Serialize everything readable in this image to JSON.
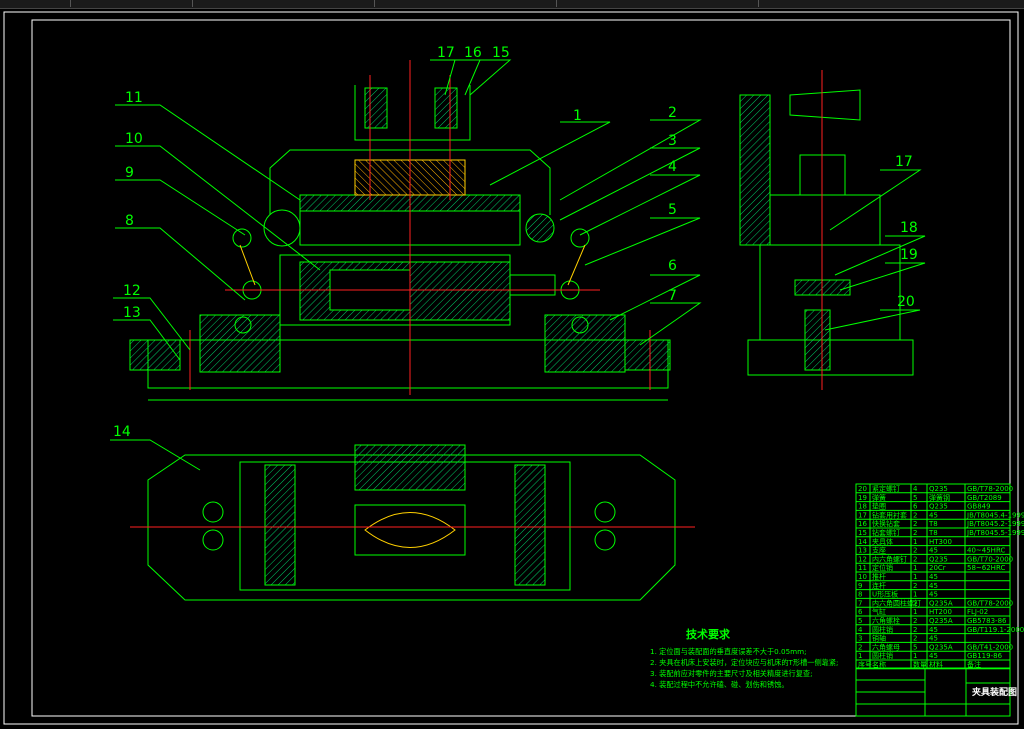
{
  "title_block": {
    "drawing_title": "夹具装配图"
  },
  "technical_requirements": {
    "heading": "技术要求",
    "items": [
      "1. 定位面与装配面的垂直度误差不大于0.05mm;",
      "2. 夹具在机床上安装时，定位块应与机床的T形槽一侧靠紧;",
      "3. 装配前应对零件的主要尺寸及相关精度进行复查;",
      "4. 装配过程中不允许磕、碰、划伤和锈蚀。"
    ]
  },
  "balloons_front": [
    "17",
    "16",
    "15",
    "1",
    "2",
    "3",
    "4",
    "5",
    "6",
    "7",
    "11",
    "10",
    "9",
    "8",
    "12",
    "13"
  ],
  "balloons_side": [
    "17",
    "18",
    "19",
    "20"
  ],
  "balloons_top": [
    "14"
  ],
  "bom": {
    "headers": [
      "序号",
      "名称",
      "数量",
      "材料",
      "备注"
    ],
    "rows": [
      [
        "20",
        "紧定螺钉",
        "4",
        "Q235",
        "GB/T78-2000"
      ],
      [
        "19",
        "弹簧",
        "5",
        "弹簧钢",
        "GB/T2089"
      ],
      [
        "18",
        "垫圈",
        "6",
        "Q235",
        "GB849"
      ],
      [
        "17",
        "钻套用衬套",
        "2",
        "45",
        "JB/T8045.4-1999"
      ],
      [
        "16",
        "快换钻套",
        "2",
        "T8",
        "JB/T8045.2-1999"
      ],
      [
        "15",
        "钻套螺钉",
        "2",
        "T8",
        "JB/T8045.5-1999"
      ],
      [
        "14",
        "夹具体",
        "1",
        "HT300",
        ""
      ],
      [
        "13",
        "支座",
        "2",
        "45",
        "40~45HRC"
      ],
      [
        "12",
        "内六角螺钉",
        "2",
        "Q235",
        "GB/T70-2000"
      ],
      [
        "11",
        "定位销",
        "1",
        "20Cr",
        "58~62HRC"
      ],
      [
        "10",
        "推杆",
        "1",
        "45",
        ""
      ],
      [
        "9",
        "连杆",
        "2",
        "45",
        ""
      ],
      [
        "8",
        "U形压板",
        "1",
        "45",
        ""
      ],
      [
        "7",
        "内六角圆柱螺钉",
        "2",
        "Q235A",
        "GB/T78-2000"
      ],
      [
        "6",
        "气缸",
        "1",
        "HT200",
        "FLJ-02"
      ],
      [
        "5",
        "六角螺栓",
        "2",
        "Q235A",
        "GB5783-86"
      ],
      [
        "4",
        "圆柱销",
        "2",
        "45",
        "GB/T119.1-2000"
      ],
      [
        "3",
        "销轴",
        "2",
        "45",
        ""
      ],
      [
        "2",
        "六角螺母",
        "5",
        "Q235A",
        "GB/T41-2000"
      ],
      [
        "1",
        "圆柱销",
        "1",
        "45",
        "GB119-86"
      ]
    ]
  },
  "colors": {
    "background": "#000000",
    "outline": "#00ff00",
    "border": "#ffffff",
    "centerline": "#ff2020",
    "workpiece": "#ffd000"
  }
}
